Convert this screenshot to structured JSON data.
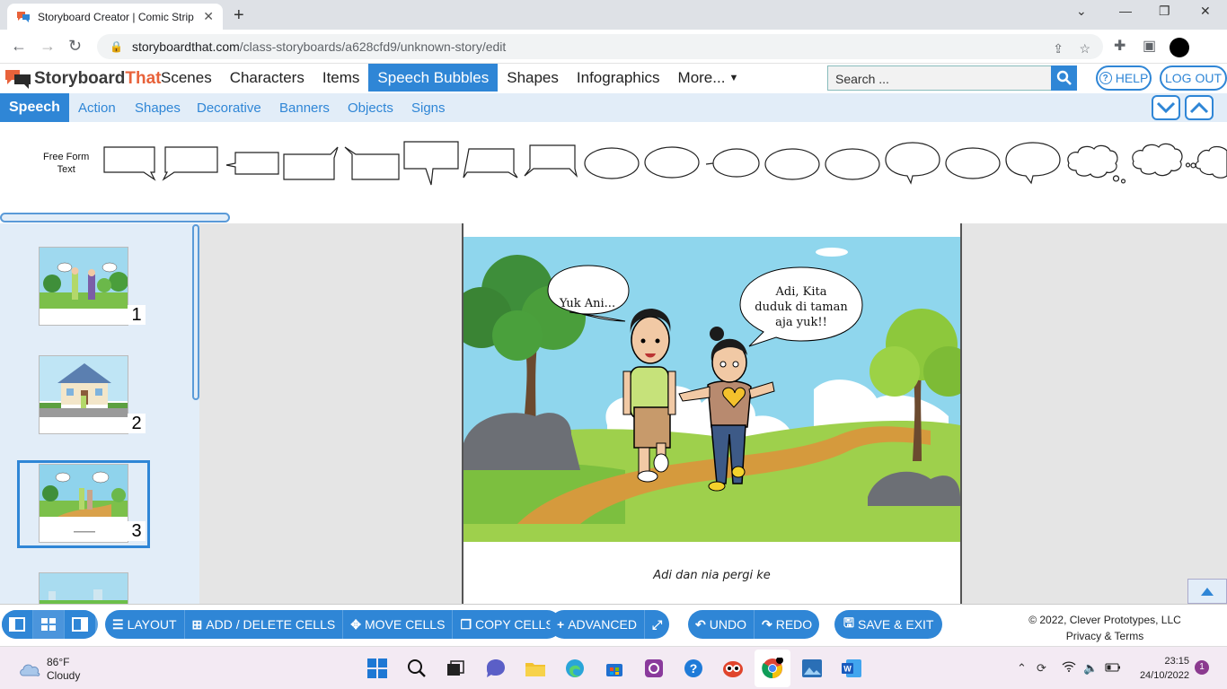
{
  "browser": {
    "tab_title": "Storyboard Creator | Comic Strip",
    "url_host": "storyboardthat.com",
    "url_path": "/class-storyboards/a628cfd9/unknown-story/edit"
  },
  "app": {
    "logo_part1": "Storyboard",
    "logo_part2": "That",
    "menu": [
      "Scenes",
      "Characters",
      "Items",
      "Speech Bubbles",
      "Shapes",
      "Infographics",
      "More..."
    ],
    "active_menu": "Speech Bubbles",
    "search_placeholder": "Search ...",
    "help_label": "HELP",
    "logout_label": "LOG OUT"
  },
  "subtabs": [
    "Speech",
    "Action",
    "Shapes",
    "Decorative",
    "Banners",
    "Objects",
    "Signs"
  ],
  "palette": {
    "free_form_label_1": "Free Form",
    "free_form_label_2": "Text"
  },
  "thumbnails": [
    {
      "number": "1"
    },
    {
      "number": "2"
    },
    {
      "number": "3"
    }
  ],
  "scene": {
    "bubble_left": "Yuk Ani...",
    "bubble_right_1": "Adi, Kita",
    "bubble_right_2": "duduk di taman",
    "bubble_right_3": "aja yuk!!",
    "caption": "Adi dan nia pergi ke"
  },
  "toolbar": {
    "layout": "LAYOUT",
    "add_delete": "ADD / DELETE CELLS",
    "move": "MOVE CELLS",
    "copy": "COPY CELLS",
    "advanced": "ADVANCED",
    "undo": "UNDO",
    "redo": "REDO",
    "save_exit": "SAVE & EXIT",
    "copyright": "© 2022, Clever Prototypes, LLC",
    "privacy": "Privacy & Terms"
  },
  "taskbar": {
    "temp": "86°F",
    "weather": "Cloudy",
    "time": "23:15",
    "date": "24/10/2022",
    "notifications": "1"
  },
  "colors": {
    "accent": "#2f86d6",
    "subbar_bg": "#e2edf8",
    "logo_orange": "#e8623a"
  }
}
